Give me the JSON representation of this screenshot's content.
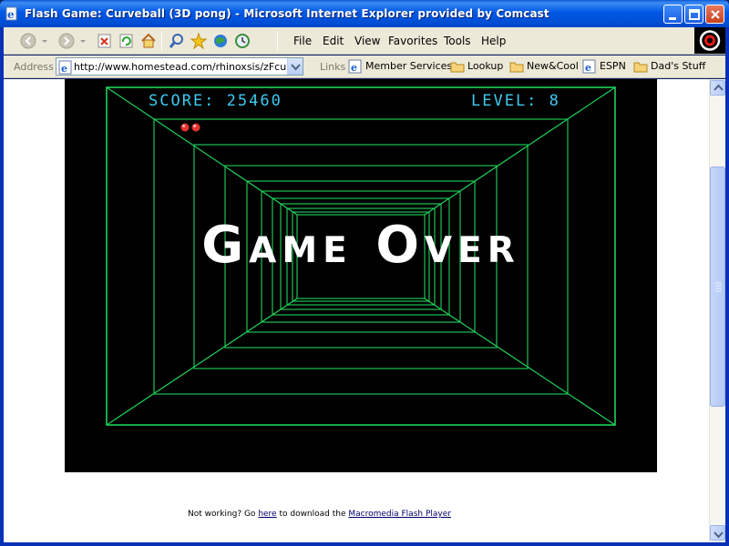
{
  "window": {
    "title": "Flash Game: Curveball (3D pong)  - Microsoft Internet Explorer provided by Comcast"
  },
  "menu": {
    "items": [
      "File",
      "Edit",
      "View",
      "Favorites",
      "Tools",
      "Help"
    ]
  },
  "address": {
    "label": "Address",
    "url": "http://www.homestead.com/rhinoxsis/zFcurveba"
  },
  "links": {
    "label": "Links",
    "items": [
      "Member Services",
      "Lookup",
      "New&Cool",
      "ESPN",
      "Dad's Stuff"
    ]
  },
  "game": {
    "score_label": "SCORE: 25460",
    "level_label": "LEVEL: 8",
    "lives_remaining": 2,
    "game_over_text": "Game Over"
  },
  "footer": {
    "prefix": "Not working? Go ",
    "here_link": "here",
    "middle": " to download the ",
    "flash_link": "Macromedia Flash Player"
  },
  "colors": {
    "tunnel_green": "#1fd35a",
    "hud_cyan": "#3ecaf0",
    "lives_red": "#e8322e"
  }
}
